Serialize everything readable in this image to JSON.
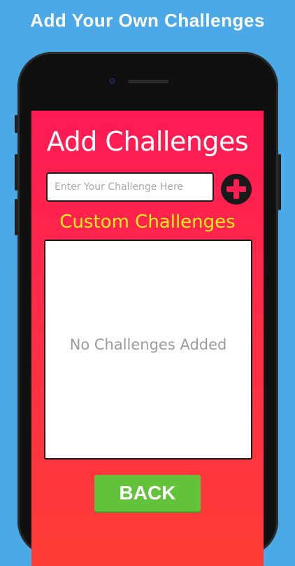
{
  "promo": {
    "title": "Add Your Own Challenges"
  },
  "screen": {
    "title": "Add Challenges",
    "input": {
      "placeholder": "Enter Your Challenge Here",
      "value": ""
    },
    "add_icon": "plus-icon",
    "section_title": "Custom Challenges",
    "empty_text": "No Challenges Added",
    "back_label": "BACK"
  },
  "colors": {
    "background": "#4aa9e6",
    "screen_top": "#ff1a55",
    "screen_bottom": "#ff3d37",
    "section_title": "#ffef1a",
    "back_button": "#62c23a",
    "phone_body": "#101010"
  }
}
